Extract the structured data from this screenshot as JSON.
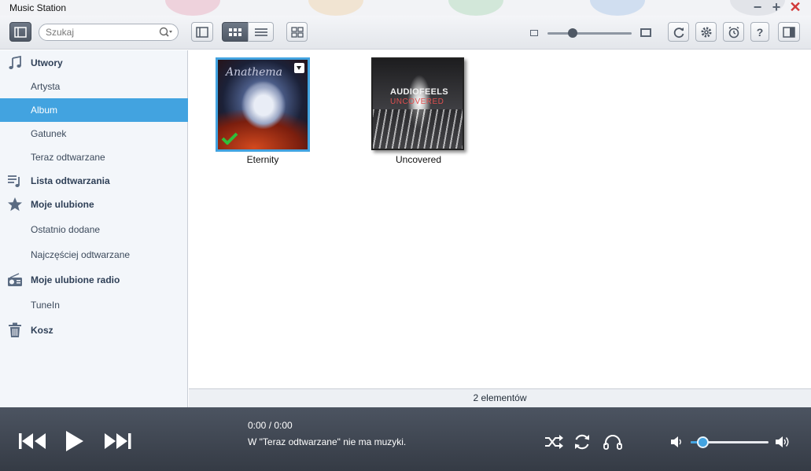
{
  "window": {
    "title": "Music Station"
  },
  "search": {
    "placeholder": "Szukaj"
  },
  "sidebar": {
    "items": [
      {
        "label": "Utwory",
        "kind": "main",
        "icon": "music-note-icon"
      },
      {
        "label": "Artysta",
        "kind": "sub"
      },
      {
        "label": "Album",
        "kind": "sub",
        "selected": true
      },
      {
        "label": "Gatunek",
        "kind": "sub"
      },
      {
        "label": "Teraz odtwarzane",
        "kind": "sub"
      },
      {
        "label": "Lista odtwarzania",
        "kind": "main",
        "icon": "playlist-icon"
      },
      {
        "label": "Moje ulubione",
        "kind": "main",
        "icon": "star-icon"
      },
      {
        "label": "Ostatnio dodane",
        "kind": "sub"
      },
      {
        "label": "Najczęściej odtwarzane",
        "kind": "sub"
      },
      {
        "label": "Moje ulubione radio",
        "kind": "main",
        "icon": "radio-icon"
      },
      {
        "label": "TuneIn",
        "kind": "sub"
      },
      {
        "label": "Kosz",
        "kind": "main",
        "icon": "trash-icon"
      }
    ]
  },
  "albums": [
    {
      "title": "Eternity",
      "cover_text": "Anathema",
      "selected": true
    },
    {
      "title": "Uncovered",
      "cover_text_1": "AUDIOFEELS",
      "cover_text_2": "UNCOVERED",
      "selected": false
    }
  ],
  "status": {
    "count_text": "2 elementów"
  },
  "player": {
    "time": "0:00 / 0:00",
    "message": "W \"Teraz odtwarzane\" nie ma muzyki.",
    "volume": 0.15
  },
  "colors": {
    "accent": "#42a3e0",
    "player_bg": "#3f4652",
    "sidebar_bg": "#f3f6fa"
  }
}
